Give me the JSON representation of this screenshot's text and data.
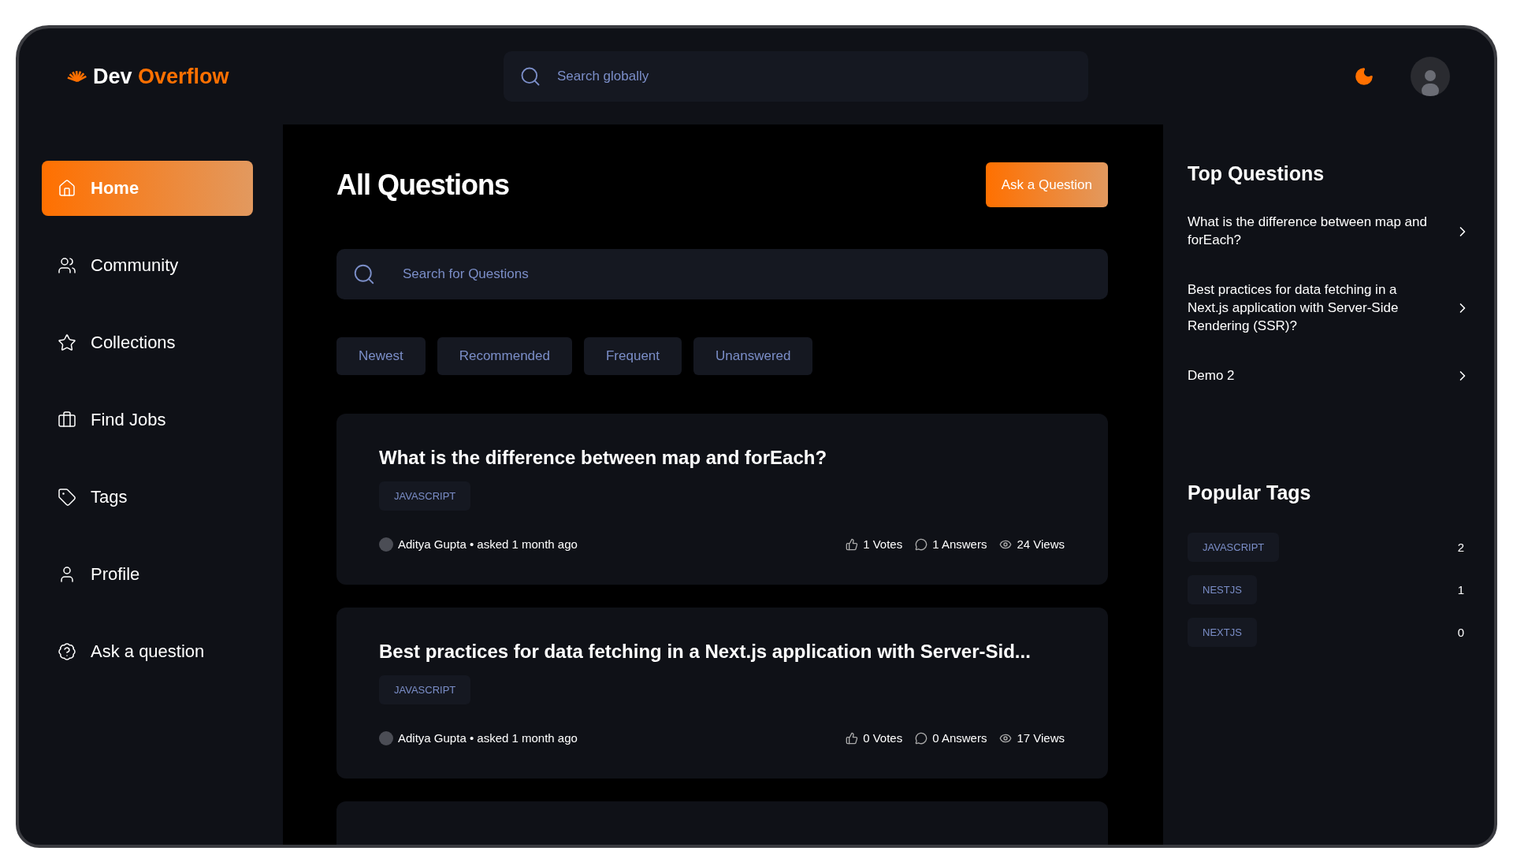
{
  "logo": {
    "first": "Dev",
    "second": "Overflow"
  },
  "global_search": {
    "placeholder": "Search globally"
  },
  "nav": [
    {
      "label": "Home",
      "selected": true
    },
    {
      "label": "Community",
      "selected": false
    },
    {
      "label": "Collections",
      "selected": false
    },
    {
      "label": "Find Jobs",
      "selected": false
    },
    {
      "label": "Tags",
      "selected": false
    },
    {
      "label": "Profile",
      "selected": false
    },
    {
      "label": "Ask a question",
      "selected": false
    }
  ],
  "page_title": "All Questions",
  "ask_button": "Ask a Question",
  "question_search": {
    "placeholder": "Search for Questions"
  },
  "filters": [
    {
      "label": "Newest",
      "selected": false
    },
    {
      "label": "Recommended",
      "selected": false
    },
    {
      "label": "Frequent",
      "selected": false
    },
    {
      "label": "Unanswered",
      "selected": false
    }
  ],
  "questions": [
    {
      "title": "What is the difference between map and forEach?",
      "tags": [
        "JAVASCRIPT"
      ],
      "author": "Aditya Gupta",
      "asked": "• asked 1 month ago",
      "votes": "1 Votes",
      "answers": "1 Answers",
      "views": "24 Views"
    },
    {
      "title": "Best practices for data fetching in a Next.js application with Server-Sid...",
      "tags": [
        "JAVASCRIPT"
      ],
      "author": "Aditya Gupta",
      "asked": "• asked 1 month ago",
      "votes": "0 Votes",
      "answers": "0 Answers",
      "views": "17 Views"
    }
  ],
  "top_questions": {
    "title": "Top Questions",
    "items": [
      "What is the difference between map and forEach?",
      "Best practices for data fetching in a Next.js application with Server-Side Rendering (SSR)?",
      "Demo 2"
    ]
  },
  "popular_tags": {
    "title": "Popular Tags",
    "items": [
      {
        "name": "JAVASCRIPT",
        "count": "2"
      },
      {
        "name": "NESTJS",
        "count": "1"
      },
      {
        "name": "NEXTJS",
        "count": "0"
      }
    ]
  }
}
